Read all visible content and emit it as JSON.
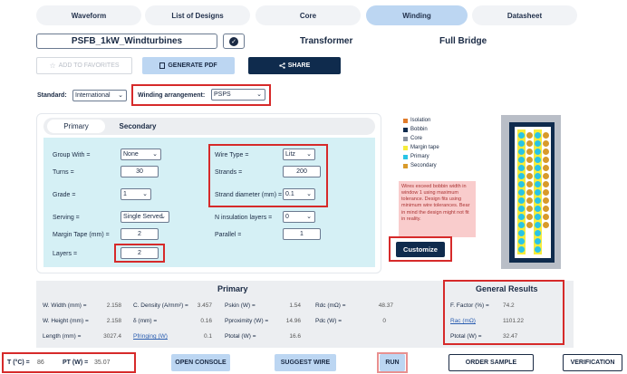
{
  "nav": {
    "tabs": [
      {
        "label": "Waveform"
      },
      {
        "label": "List of Designs"
      },
      {
        "label": "Core"
      },
      {
        "label": "Winding"
      },
      {
        "label": "Datasheet"
      }
    ],
    "active": "Winding"
  },
  "design": {
    "name": "PSFB_1kW_Windturbines",
    "type": "Transformer",
    "topology": "Full Bridge"
  },
  "toolbar": {
    "favorites_label": "ADD TO FAVORITES",
    "pdf_label": "GENERATE PDF",
    "share_label": "SHARE"
  },
  "settings": {
    "standard_label": "Standard:",
    "standard_value": "International",
    "arrangement_label": "Winding arrangement:",
    "arrangement_value": "PSPS"
  },
  "winding_tabs": {
    "primary": "Primary",
    "secondary": "Secondary"
  },
  "form": {
    "group_with_label": "Group With =",
    "group_with_value": "None",
    "turns_label": "Turns =",
    "turns_value": "30",
    "grade_label": "Grade =",
    "grade_value": "1",
    "serving_label": "Serving =",
    "serving_value": "Single Served",
    "margin_tape_label": "Margin Tape (mm) =",
    "margin_tape_value": "2",
    "layers_label": "Layers =",
    "layers_value": "2",
    "wire_type_label": "Wire Type =",
    "wire_type_value": "Litz",
    "strands_label": "Strands =",
    "strands_value": "200",
    "strand_diameter_label": "Strand diameter (mm) =",
    "strand_diameter_value": "0.1",
    "n_insulation_label": "N insulation layers =",
    "n_insulation_value": "0",
    "parallel_label": "Parallel =",
    "parallel_value": "1"
  },
  "legend": [
    {
      "label": "Isolation",
      "color": "#e07b2a"
    },
    {
      "label": "Bobbin",
      "color": "#0f2b4d"
    },
    {
      "label": "Core",
      "color": "#8a93a0"
    },
    {
      "label": "Margin tape",
      "color": "#f6ec3a"
    },
    {
      "label": "Primary",
      "color": "#29c4e6"
    },
    {
      "label": "Secondary",
      "color": "#d99a2a"
    }
  ],
  "warning": "Wires exceed bobbin width in window 1 using maximum tolerance. Design fits using minimum wire tolerances. Bear in mind the design might not fit in reality.",
  "customize_label": "Customize",
  "primary_results": {
    "title": "Primary",
    "w_width_label": "W. Width (mm) =",
    "w_width_value": "2.158",
    "w_height_label": "W. Height (mm) =",
    "w_height_value": "2.158",
    "length_label": "Length (mm) =",
    "length_value": "3027.4",
    "c_density_label": "C. Density (A/mm²) =",
    "c_density_value": "3.457",
    "delta_label": "δ (mm) =",
    "delta_value": "0.16",
    "pfringing_label": "Pfringing (W)",
    "pfringing_value": "0.1",
    "pskin_label": "Pskin (W) =",
    "pskin_value": "1.54",
    "pproximity_label": "Pproximity (W) =",
    "pproximity_value": "14.96",
    "ptotal_label": "Ptotal (W) =",
    "ptotal_value": "16.6",
    "rdc_label": "Rdc (mΩ) =",
    "rdc_value": "48.37",
    "pdc_label": "Pdc (W) =",
    "pdc_value": "0"
  },
  "general_results": {
    "title": "General Results",
    "ffactor_label": "F. Factor (%) =",
    "ffactor_value": "74.2",
    "rac_label": "Rac (mΩ)",
    "rac_value": "1101.22",
    "ptotal_label": "Ptotal (W) =",
    "ptotal_value": "32.47"
  },
  "bottom": {
    "temp_label": "T (°C) =",
    "temp_value": "86",
    "pt_label": "PT (W) =",
    "pt_value": "35.07",
    "open_console": "OPEN CONSOLE",
    "suggest_wire": "SUGGEST WIRE",
    "run": "RUN",
    "order_sample": "ORDER SAMPLE",
    "verification": "VERIFICATION"
  }
}
